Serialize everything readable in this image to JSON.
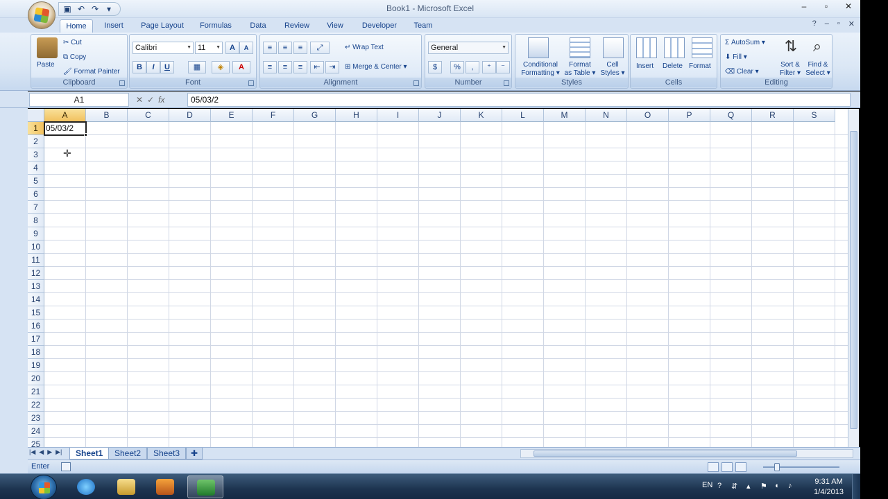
{
  "window": {
    "title": "Book1 - Microsoft Excel",
    "controls": {
      "minimize": "–",
      "maximize": "▫",
      "close": "✕"
    }
  },
  "quick_access": {
    "save_icon": "save-icon",
    "undo_icon": "undo-icon",
    "redo_icon": "redo-icon",
    "customize": "▾"
  },
  "tabs": [
    "Home",
    "Insert",
    "Page Layout",
    "Formulas",
    "Data",
    "Review",
    "View",
    "Developer",
    "Team"
  ],
  "active_tab": "Home",
  "ribbon": {
    "clipboard": {
      "label": "Clipboard",
      "paste": "Paste",
      "cut": "Cut",
      "copy": "Copy",
      "format_painter": "Format Painter"
    },
    "font": {
      "label": "Font",
      "family": "Calibri",
      "size": "11",
      "grow": "A",
      "shrink": "A",
      "bold": "B",
      "italic": "I",
      "underline": "U",
      "font_color": "A"
    },
    "alignment": {
      "label": "Alignment",
      "wrap_text": "Wrap Text",
      "merge_center": "Merge & Center"
    },
    "number": {
      "label": "Number",
      "format": "General",
      "currency": "$",
      "percent": "%",
      "comma": ","
    },
    "styles": {
      "label": "Styles",
      "conditional": "Conditional",
      "conditional2": "Formatting",
      "format_table": "Format",
      "format_table2": "as Table",
      "cell_styles": "Cell",
      "cell_styles2": "Styles"
    },
    "cells": {
      "label": "Cells",
      "insert": "Insert",
      "delete": "Delete",
      "format": "Format"
    },
    "editing": {
      "label": "Editing",
      "autosum": "AutoSum",
      "fill": "Fill",
      "clear": "Clear",
      "sort": "Sort &",
      "sort2": "Filter",
      "find": "Find &",
      "find2": "Select"
    }
  },
  "formula_bar": {
    "name_box": "A1",
    "fx": "fx",
    "content": "05/03/2"
  },
  "columns": [
    "A",
    "B",
    "C",
    "D",
    "E",
    "F",
    "G",
    "H",
    "I",
    "J",
    "K",
    "L",
    "M",
    "N",
    "O",
    "P",
    "Q",
    "R",
    "S"
  ],
  "rows": [
    "1",
    "2",
    "3",
    "4",
    "5",
    "6",
    "7",
    "8",
    "9",
    "10",
    "11",
    "12",
    "13",
    "14",
    "15",
    "16",
    "17",
    "18",
    "19",
    "20",
    "21",
    "22",
    "23",
    "24",
    "25"
  ],
  "active_cell": {
    "ref": "A1",
    "value": "05/03/2"
  },
  "sheets": [
    "Sheet1",
    "Sheet2",
    "Sheet3"
  ],
  "active_sheet": "Sheet1",
  "status": {
    "mode": "Enter"
  },
  "taskbar": {
    "language": "EN",
    "time": "9:31 AM",
    "date": "1/4/2013"
  }
}
